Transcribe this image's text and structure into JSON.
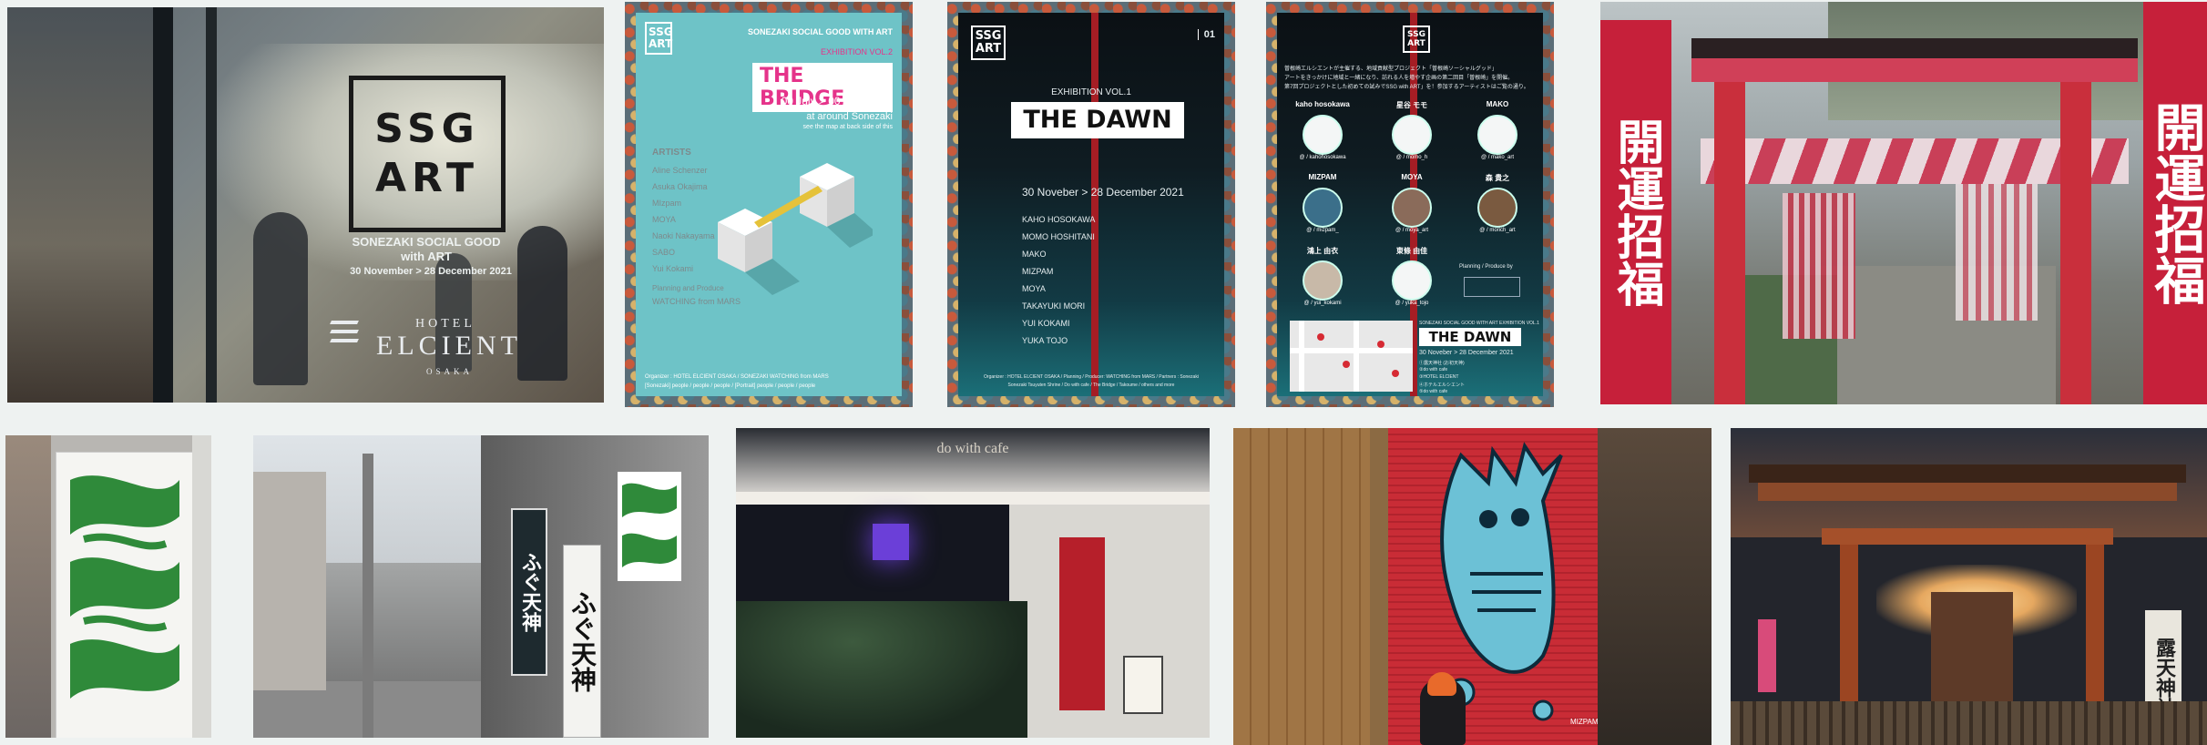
{
  "hotel_window": {
    "logo_line1": "SSG",
    "logo_line2": "ART",
    "tagline1": "SONEZAKI SOCIAL GOOD",
    "tagline2": "with ART",
    "dates": "30 November > 28 December 2021",
    "hotel": "HOTEL",
    "hotel_name": "ELCIENT",
    "hotel_city": "OSAKA"
  },
  "poster_bridge": {
    "logo_line1": "SSG",
    "logo_line2": "ART",
    "org": "SONEZAKI SOCIAL GOOD WITH ART",
    "exhibition": "EXHIBITION VOL.2",
    "title": "THE BRIDGE",
    "dates": "00 July > 00 Aug. 2022",
    "location": "at around Sonezaki",
    "location_note": "see the map at back side of this",
    "artists_heading": "ARTISTS",
    "artists": [
      "Aline Schenzer",
      "Asuka Okajima",
      "MIzpam",
      "MOYA",
      "Naoki Nakayama",
      "SABO",
      "Yui Kokami"
    ],
    "planning_label": "Planning and Produce",
    "planner": "WATCHING from MARS",
    "footer1": "Organizer : HOTEL ELCIENT OSAKA / SONEZAKI WATCHING from MARS",
    "footer2": "[Sonezaki] people / people / people / [Portrait] people / people / people"
  },
  "poster_dawn": {
    "logo_line1": "SSG",
    "logo_line2": "ART",
    "page_no": "01",
    "exhibition": "EXHIBITION VOL.1",
    "title": "THE DAWN",
    "dates": "30 Noveber > 28 December 2021",
    "artists": [
      "KAHO HOSOKAWA",
      "MOMO HOSHITANI",
      "MAKO",
      "MIZPAM",
      "MOYA",
      "TAKAYUKI MORI",
      "YUI KOKAMI",
      "YUKA TOJO"
    ],
    "footer1": "Organizer : HOTEL ELCIENT OSAKA / Planning / Producer: WATCHING from MARS / Partners : Sonezaki",
    "footer2": "Sonezaki Tsuyuten Shrine / Do with cafe / The Bridge / Takoume / others and more"
  },
  "poster_dawn_back": {
    "logo_line1": "SSG",
    "logo_line2": "ART",
    "intro1": "曽根崎エルシエントが主催する、地域貢献型プロジェクト「曽根崎ソーシャルグッド」",
    "intro2": "アートをきっかけに地域と一緒になり、訪れる人を増やす企画の第二回目「曽根崎」を開催。",
    "intro3": "第7回プロジェクトとした初めての試みでSSG with ART」を！参加するアーティストはご覧の通り。",
    "artists": [
      {
        "name": "kaho hosokawa",
        "handle": "@ / kahohosokawa"
      },
      {
        "name": "星谷 モモ",
        "handle": "@ / momo_h"
      },
      {
        "name": "MAKO",
        "handle": "@ / mako_art"
      },
      {
        "name": "MIZPAM",
        "handle": "@ / mizpam_"
      },
      {
        "name": "MOYA",
        "handle": "@ / moya_art"
      },
      {
        "name": "森 貴之",
        "handle": "@ / morich_art"
      },
      {
        "name": "鴻上 由衣",
        "handle": "@ / yui_kokami"
      },
      {
        "name": "東條 由佳",
        "handle": "@ / yuka_tojo"
      }
    ],
    "planning": "Planning / Produce by",
    "org_small": "SONEZAKI SOCIAL GOOD WITH ART EXHIBITION VOL.1",
    "title": "THE DAWN",
    "dates": "30 Noveber > 28 December 2021",
    "venues": [
      "①露天神社 (お初天神)",
      "②do with cafe",
      "③HOTEL ELCIENT",
      "④ホテルエルシエント",
      "⑤do with cafe"
    ]
  },
  "torii": {
    "banner_left": "開運招福",
    "banner_right": "開運招福"
  },
  "street": {
    "sign_fugu": "ふぐ天神",
    "sign_tenjin": "ふぐ天神"
  },
  "cafe": {
    "sign": "do with cafe"
  },
  "shutter": {
    "signature": "MIZPAM"
  },
  "shrine_night": {
    "sign": "露天神社"
  },
  "colors": {
    "teal": "#6ec3c7",
    "pink": "#e5338a",
    "dawn_red": "#a51d24",
    "torii_red": "#c92f3c",
    "green_art": "#2f8a3a"
  }
}
